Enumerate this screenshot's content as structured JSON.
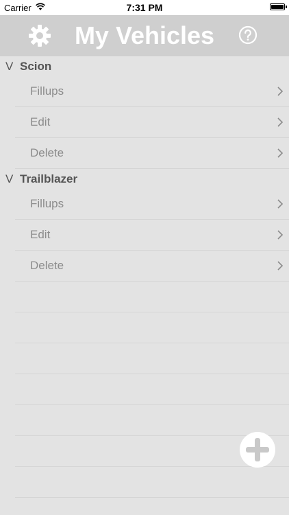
{
  "status_bar": {
    "carrier": "Carrier",
    "time": "7:31 PM",
    "wifi_icon": "wifi-icon",
    "battery_icon": "battery-icon",
    "battery_level": 1.0
  },
  "nav": {
    "title": "My Vehicles",
    "settings_icon": "gear-icon",
    "help_icon": "question-circle-icon"
  },
  "vehicles": [
    {
      "name": "Scion",
      "actions": [
        "Fillups",
        "Edit",
        "Delete"
      ]
    },
    {
      "name": "Trailblazer",
      "actions": [
        "Fillups",
        "Edit",
        "Delete"
      ]
    }
  ],
  "add_button": {
    "icon": "plus-icon"
  },
  "colors": {
    "background": "#e3e3e3",
    "nav_background": "#cfcfcf",
    "header_text": "#555555",
    "row_text": "#8c8c8c",
    "separator": "#d5d5d5"
  }
}
